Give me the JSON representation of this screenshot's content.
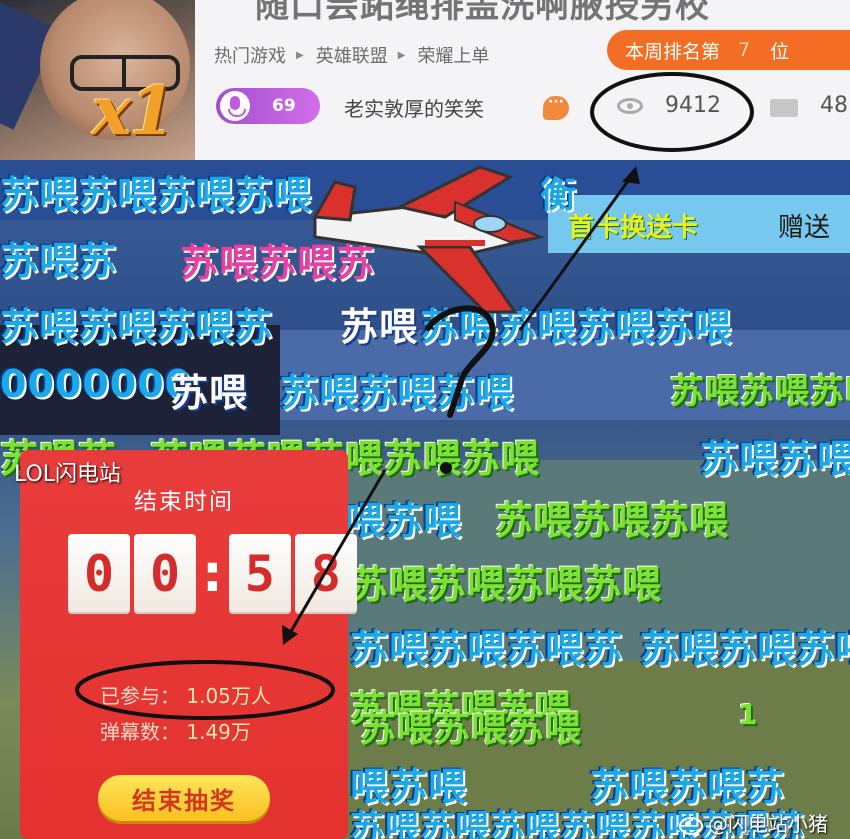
{
  "header": {
    "title_partial": "随口尝跖绳排盖洗啊腋授另校",
    "multiplier": "x1",
    "breadcrumb": [
      "热门游戏",
      "英雄联盟",
      "荣耀上单"
    ],
    "rank": {
      "prefix": "本周排名第",
      "number": "7",
      "suffix": "位"
    },
    "level": "69",
    "streamer_name": "老实敦厚的笑笑",
    "viewer_count": "9412",
    "follow_count": "48"
  },
  "video": {
    "gift_text": "首卡换送卡",
    "gift_send": "赠送",
    "danmaku": [
      {
        "text": "苏喂苏喂苏喂苏喂",
        "style": "dm-blue"
      },
      {
        "text": "衡",
        "style": "dm-blue"
      },
      {
        "text": "苏喂苏",
        "style": "dm-blue"
      },
      {
        "text": "苏喂苏喂苏",
        "style": "dm-pink"
      },
      {
        "text": "苏喂苏喂苏喂苏",
        "style": "dm-blue"
      },
      {
        "text": "苏喂",
        "style": "dm-white"
      },
      {
        "text": "苏喂苏喂苏喂苏喂",
        "style": "dm-blue"
      },
      {
        "text": "0000000",
        "style": "dm-blue"
      },
      {
        "text": "苏喂",
        "style": "dm-white"
      },
      {
        "text": "苏喂苏喂苏喂",
        "style": "dm-blue"
      },
      {
        "text": "苏喂苏喂苏喂苏喂",
        "style": "dm-green"
      },
      {
        "text": "苏喂苏",
        "style": "dm-green"
      },
      {
        "text": "苏喂苏喂苏喂苏喂苏喂",
        "style": "dm-green"
      },
      {
        "text": "苏喂苏喂苏喂",
        "style": "dm-blue"
      },
      {
        "text": "喂苏喂",
        "style": "dm-blue"
      },
      {
        "text": "苏喂苏喂苏喂",
        "style": "dm-green"
      },
      {
        "text": "苏喂苏喂苏喂苏喂",
        "style": "dm-green"
      },
      {
        "text": "苏喂苏喂苏喂苏",
        "style": "dm-blue"
      },
      {
        "text": "苏喂苏喂苏喂",
        "style": "dm-blue"
      },
      {
        "text": "苏喂苏喂苏喂",
        "style": "dm-green"
      },
      {
        "text": "苏喂苏喂苏喂",
        "style": "dm-green"
      },
      {
        "text": "喂苏喂",
        "style": "dm-blue"
      },
      {
        "text": "苏喂苏喂苏",
        "style": "dm-blue"
      },
      {
        "text": "苏喂苏喂苏喂",
        "style": "dm-blue"
      },
      {
        "text": "苏喂苏喂苏喂苏",
        "style": "dm-blue"
      },
      {
        "text": "1",
        "style": "dm-green"
      }
    ]
  },
  "lottery": {
    "watermark": "LOL闪电站",
    "title": "结束时间",
    "digits": [
      "0",
      "0",
      "5",
      "8"
    ],
    "participants_label": "已参与：",
    "participants_value": "1.05万人",
    "danmaku_label": "弹幕数：",
    "danmaku_value": "1.49万",
    "button": "结束抽奖"
  },
  "footer": {
    "weibo_handle": "@闪电站小猪"
  },
  "colors": {
    "rank_badge": "#f36e24",
    "lottery_card": "#e4322e",
    "lottery_button": "#f9c020",
    "danmaku_blue": "#1ba8e8",
    "danmaku_green": "#7be232"
  }
}
